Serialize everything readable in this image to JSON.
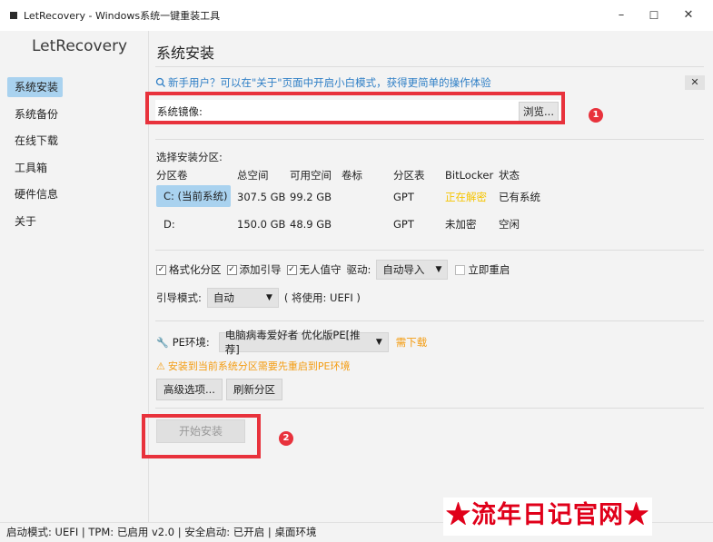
{
  "window": {
    "title": "LetRecovery - Windows系统一键重装工具",
    "minimize": "–",
    "maximize": "☐",
    "close": "✕"
  },
  "sidebar": {
    "app_name": "LetRecovery",
    "items": [
      {
        "label": "系统安装",
        "active": true
      },
      {
        "label": "系统备份"
      },
      {
        "label": "在线下载"
      },
      {
        "label": "工具箱"
      },
      {
        "label": "硬件信息"
      },
      {
        "label": "关于"
      }
    ]
  },
  "main": {
    "page_title": "系统安装",
    "tip": "新手用户？可以在\"关于\"页面中开启小白模式，获得更简单的操作体验",
    "tip_close": "✕",
    "image_label": "系统镜像:",
    "image_value": "",
    "browse_label": "浏览...",
    "partition_label": "选择安装分区:",
    "table": {
      "headers": [
        "分区卷",
        "总空间",
        "可用空间",
        "卷标",
        "分区表",
        "BitLocker",
        "状态"
      ],
      "rows": [
        [
          "C: (当前系统)",
          "307.5 GB",
          "99.2 GB",
          "",
          "GPT",
          "正在解密",
          "已有系统"
        ],
        [
          "D:",
          "150.0 GB",
          "48.9 GB",
          "",
          "GPT",
          "未加密",
          "空闲"
        ]
      ]
    },
    "options": {
      "format": "格式化分区",
      "add_boot": "添加引导",
      "unattended": "无人值守",
      "driver_label": "驱动:",
      "driver_value": "自动导入",
      "restart": "立即重启"
    },
    "boot": {
      "label": "引导模式:",
      "value": "自动",
      "hint": "( 将使用: UEFI )"
    },
    "pe": {
      "label": "PE环境:",
      "value": "电脑病毒爱好者 优化版PE[推荐]",
      "download": "需下载",
      "warning": "安装到当前系统分区需要先重启到PE环境"
    },
    "advanced_btn": "高级选项...",
    "refresh_btn": "刷新分区",
    "install_btn": "开始安装"
  },
  "markers": [
    "1",
    "2"
  ],
  "statusbar": "启动模式: UEFI | TPM: 已启用 v2.0 | 安全启动: 已开启 | 桌面环境",
  "watermark": "★流年日记官网★",
  "colors": {
    "accent": "#a9d2ef",
    "tip": "#2f7fc6",
    "annotation": "#e8323c",
    "warning": "#f39c12",
    "decrypting": "#f5c400"
  }
}
